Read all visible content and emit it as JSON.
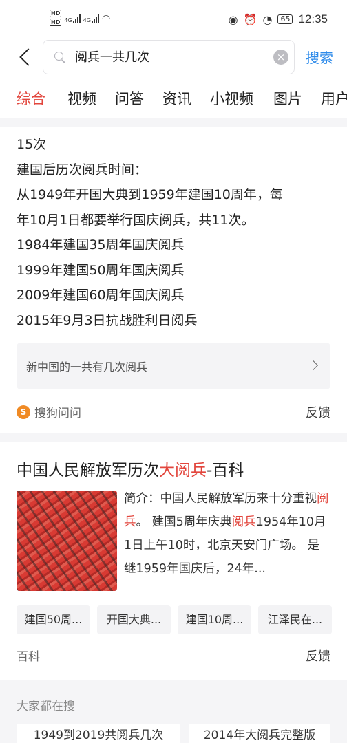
{
  "status_bar": {
    "hd1": "HD",
    "hd2": "HD",
    "net1": "4G",
    "net2": "4G",
    "battery": "65",
    "time": "12:35"
  },
  "search": {
    "query": "阅兵一共几次",
    "button_label": "搜索"
  },
  "tabs": [
    "综合",
    "视频",
    "问答",
    "资讯",
    "小视频",
    "图片",
    "用户"
  ],
  "answer_card": {
    "lines": [
      "15次",
      "建国后历次阅兵时间：",
      "从1949年开国大典到1959年建国10周年，每",
      "年10月1日都要举行国庆阅兵，共11次。",
      "1984年建国35周年国庆阅兵",
      "1999年建国50周年国庆阅兵",
      "2009年建国60周年国庆阅兵",
      "2015年9月3日抗战胜利日阅兵"
    ],
    "related_question": "新中国的一共有几次阅兵",
    "source": "搜狗问问",
    "source_logo": "S",
    "feedback": "反馈"
  },
  "baike_card": {
    "title_prefix": "中国人民解放军历次",
    "title_highlight": "大阅兵",
    "title_suffix": "-百科",
    "snippet_parts": [
      {
        "text": "简介：中国人民解放军历来十分重视",
        "hl": false
      },
      {
        "text": "阅兵",
        "hl": true
      },
      {
        "text": "。 建国5周年庆典",
        "hl": false
      },
      {
        "text": "阅兵",
        "hl": true
      },
      {
        "text": "1954年10月1日上午10时，北京天安门广场。 是继1959年国庆后，24年...",
        "hl": false
      }
    ],
    "chips": [
      "建国50周...",
      "开国大典...",
      "建国10周...",
      "江泽民在..."
    ],
    "source": "百科",
    "feedback": "反馈"
  },
  "hot_searches": {
    "title": "大家都在搜",
    "items": [
      "1949到2019共阅兵几次",
      "2014年大阅兵完整版"
    ]
  }
}
